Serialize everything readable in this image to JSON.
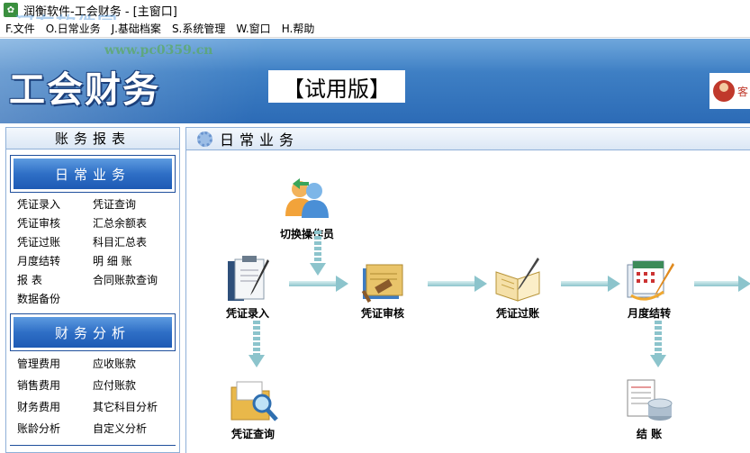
{
  "window": {
    "title": "润衡软件-工会财务 - [主窗口]"
  },
  "watermark": {
    "text": "河东软件园",
    "url": "www.pc0359.cn"
  },
  "menu": [
    {
      "label": "F.文件"
    },
    {
      "label": "O.日常业务"
    },
    {
      "label": "J.基础档案"
    },
    {
      "label": "S.系统管理"
    },
    {
      "label": "W.窗口"
    },
    {
      "label": "H.帮助"
    }
  ],
  "banner": {
    "logo": "工会财务",
    "edition": "【试用版】",
    "user_label": "客"
  },
  "sidebar": {
    "header": "账务报表",
    "sections": [
      {
        "title": "日常业务",
        "links": [
          "凭证录入",
          "凭证查询",
          "凭证审核",
          "汇总余额表",
          "凭证过账",
          "科目汇总表",
          "月度结转",
          "明 细 账",
          "报 表",
          "合同账款查询",
          "数据备份"
        ]
      },
      {
        "title": "财务分析",
        "links": [
          "管理费用",
          "应收账款",
          "销售费用",
          "应付账款",
          "财务费用",
          "其它科目分析",
          "账龄分析",
          "自定义分析"
        ]
      }
    ]
  },
  "main": {
    "title": "日常业务",
    "nodes": {
      "switch_operator": "切换操作员",
      "voucher_entry": "凭证录入",
      "voucher_audit": "凭证审核",
      "voucher_post": "凭证过账",
      "month_end": "月度结转",
      "voucher_query": "凭证查询",
      "close_books": "结 账"
    }
  },
  "colors": {
    "banner": "#2c6bb6",
    "section_head": "#1e5ab4",
    "arrow": "#8cc4cc"
  }
}
